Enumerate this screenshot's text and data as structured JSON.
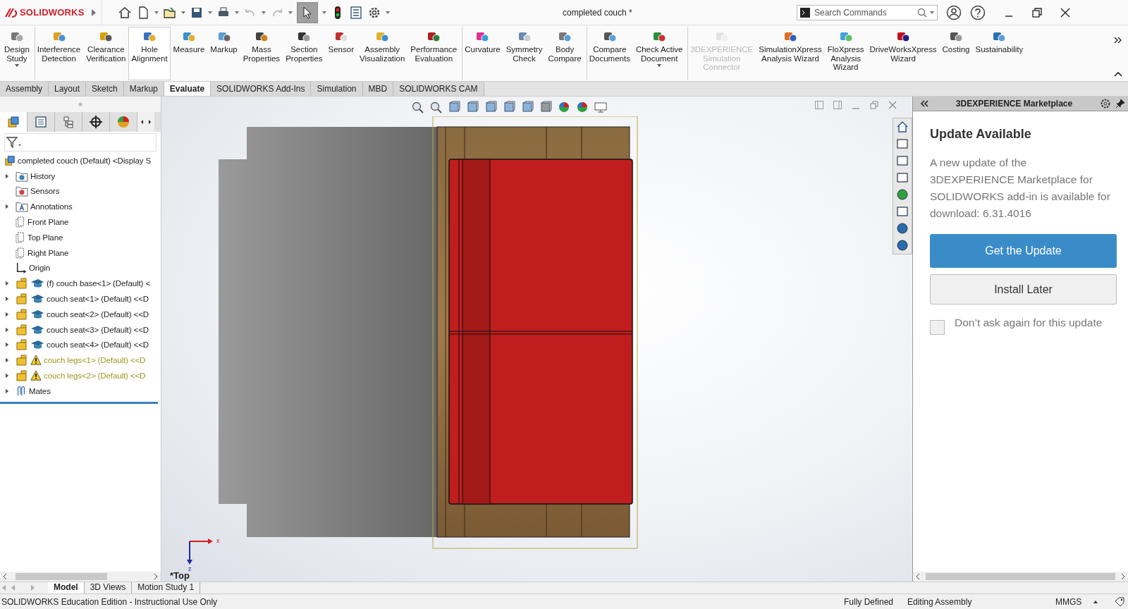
{
  "app": {
    "brand": "SOLIDWORKS",
    "document_title": "completed couch *",
    "select_tool": {
      "selected": true
    }
  },
  "search": {
    "placeholder": "Search Commands"
  },
  "commands": [
    {
      "lines": [
        "Design",
        "Study"
      ],
      "selected": false,
      "disabled": false,
      "has_menu": true,
      "separator_before": false
    },
    {
      "lines": [
        "Interference",
        "Detection"
      ],
      "selected": false,
      "disabled": false,
      "has_menu": false,
      "separator_before": true
    },
    {
      "lines": [
        "Clearance",
        "Verification"
      ],
      "selected": false,
      "disabled": false,
      "has_menu": false,
      "separator_before": false
    },
    {
      "lines": [
        "Hole",
        "Alignment"
      ],
      "selected": true,
      "disabled": false,
      "has_menu": false,
      "separator_before": false
    },
    {
      "lines": [
        "Measure"
      ],
      "selected": false,
      "disabled": false,
      "has_menu": false,
      "separator_before": false
    },
    {
      "lines": [
        "Markup"
      ],
      "selected": false,
      "disabled": false,
      "has_menu": false,
      "separator_before": false
    },
    {
      "lines": [
        "Mass",
        "Properties"
      ],
      "selected": false,
      "disabled": false,
      "has_menu": false,
      "separator_before": false
    },
    {
      "lines": [
        "Section",
        "Properties"
      ],
      "selected": false,
      "disabled": false,
      "has_menu": false,
      "separator_before": false
    },
    {
      "lines": [
        "Sensor"
      ],
      "selected": false,
      "disabled": false,
      "has_menu": false,
      "separator_before": false
    },
    {
      "lines": [
        "Assembly",
        "Visualization"
      ],
      "selected": false,
      "disabled": false,
      "has_menu": false,
      "separator_before": false
    },
    {
      "lines": [
        "Performance",
        "Evaluation"
      ],
      "selected": false,
      "disabled": false,
      "has_menu": false,
      "separator_before": false
    },
    {
      "lines": [
        "Curvature"
      ],
      "selected": false,
      "disabled": false,
      "has_menu": false,
      "separator_before": true
    },
    {
      "lines": [
        "Symmetry",
        "Check"
      ],
      "selected": false,
      "disabled": false,
      "has_menu": false,
      "separator_before": false
    },
    {
      "lines": [
        "Body",
        "Compare"
      ],
      "selected": false,
      "disabled": false,
      "has_menu": false,
      "separator_before": false
    },
    {
      "lines": [
        "Compare",
        "Documents"
      ],
      "selected": false,
      "disabled": false,
      "has_menu": false,
      "separator_before": true
    },
    {
      "lines": [
        "Check Active",
        "Document"
      ],
      "selected": false,
      "disabled": false,
      "has_menu": true,
      "separator_before": false
    },
    {
      "lines": [
        "3DEXPERIENCE",
        "Simulation",
        "Connector"
      ],
      "selected": false,
      "disabled": true,
      "has_menu": false,
      "separator_before": true
    },
    {
      "lines": [
        "SimulationXpress",
        "Analysis Wizard"
      ],
      "selected": false,
      "disabled": false,
      "has_menu": false,
      "separator_before": false
    },
    {
      "lines": [
        "FloXpress",
        "Analysis",
        "Wizard"
      ],
      "selected": false,
      "disabled": false,
      "has_menu": false,
      "separator_before": false
    },
    {
      "lines": [
        "DriveWorksXpress",
        "Wizard"
      ],
      "selected": false,
      "disabled": false,
      "has_menu": false,
      "separator_before": false
    },
    {
      "lines": [
        "Costing"
      ],
      "selected": false,
      "disabled": false,
      "has_menu": false,
      "separator_before": false
    },
    {
      "lines": [
        "Sustainability"
      ],
      "selected": false,
      "disabled": false,
      "has_menu": false,
      "separator_before": false
    }
  ],
  "tabs": [
    {
      "label": "Assembly",
      "selected": false
    },
    {
      "label": "Layout",
      "selected": false
    },
    {
      "label": "Sketch",
      "selected": false
    },
    {
      "label": "Markup",
      "selected": false
    },
    {
      "label": "Evaluate",
      "selected": true
    },
    {
      "label": "SOLIDWORKS Add-Ins",
      "selected": false
    },
    {
      "label": "Simulation",
      "selected": false
    },
    {
      "label": "MBD",
      "selected": false
    },
    {
      "label": "SOLIDWORKS CAM",
      "selected": false
    }
  ],
  "tree": {
    "label": "completed couch (Default) <Display S",
    "kind": "assembly",
    "expandable": false,
    "warning": false,
    "children": [
      {
        "label": "History",
        "kind": "history",
        "expandable": true,
        "warning": false
      },
      {
        "label": "Sensors",
        "kind": "sensors",
        "expandable": false,
        "warning": false
      },
      {
        "label": "Annotations",
        "kind": "annotations",
        "expandable": true,
        "warning": false
      },
      {
        "label": "Front Plane",
        "kind": "plane",
        "expandable": false,
        "warning": false
      },
      {
        "label": "Top Plane",
        "kind": "plane",
        "expandable": false,
        "warning": false
      },
      {
        "label": "Right Plane",
        "kind": "plane",
        "expandable": false,
        "warning": false
      },
      {
        "label": "Origin",
        "kind": "origin",
        "expandable": false,
        "warning": false
      },
      {
        "label": "(f) couch base<1> (Default) <",
        "kind": "part",
        "expandable": true,
        "warning": false
      },
      {
        "label": "couch seat<1> (Default) <<D",
        "kind": "part",
        "expandable": true,
        "warning": false
      },
      {
        "label": "couch seat<2> (Default) <<D",
        "kind": "part",
        "expandable": true,
        "warning": false
      },
      {
        "label": "couch seat<3> (Default) <<D",
        "kind": "part",
        "expandable": true,
        "warning": false
      },
      {
        "label": "couch seat<4> (Default) <<D",
        "kind": "part",
        "expandable": true,
        "warning": false
      },
      {
        "label": "couch legs<1> (Default) <<D",
        "kind": "part",
        "expandable": true,
        "warning": true
      },
      {
        "label": "couch legs<2> (Default) <<D",
        "kind": "part",
        "expandable": true,
        "warning": true
      },
      {
        "label": "Mates",
        "kind": "mates",
        "expandable": true,
        "warning": false
      }
    ]
  },
  "viewport": {
    "view_label": "*Top",
    "axis_x": "x",
    "axis_z": "z"
  },
  "marketplace": {
    "title": "3DEXPERIENCE Marketplace",
    "heading": "Update Available",
    "message": "A new update of the 3DEXPERIENCE Marketplace for SOLIDWORKS add-in is available for download: 6.31.4016",
    "primary_button": "Get the Update",
    "secondary_button": "Install Later",
    "checkbox": {
      "label": "Don’t ask again for this update",
      "checked": false
    }
  },
  "bottom_tabs": [
    {
      "label": "Model",
      "selected": true
    },
    {
      "label": "3D Views",
      "selected": false
    },
    {
      "label": "Motion Study 1",
      "selected": false
    }
  ],
  "status_bar": {
    "edition": "SOLIDWORKS Education Edition - Instructional Use Only",
    "state": "Fully Defined",
    "mode": "Editing Assembly",
    "units": "MMGS"
  }
}
